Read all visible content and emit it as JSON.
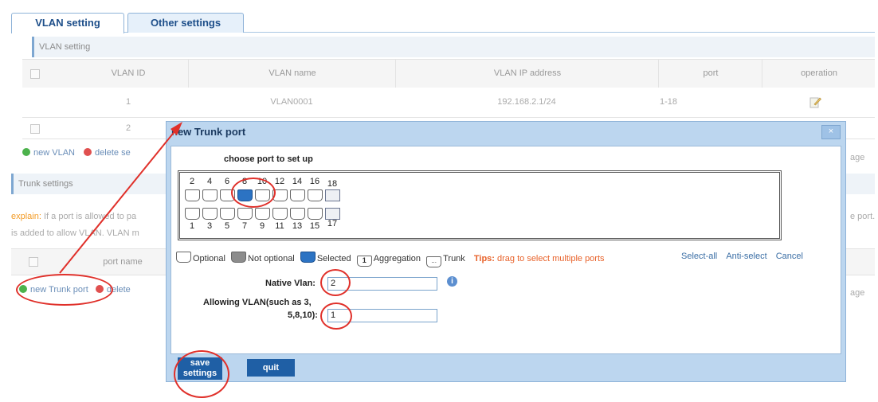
{
  "tabs": [
    {
      "label": "VLAN setting",
      "active": true
    },
    {
      "label": "Other settings",
      "active": false
    }
  ],
  "vlan_section": {
    "title": "VLAN setting",
    "columns": [
      "VLAN ID",
      "VLAN name",
      "VLAN IP address",
      "port",
      "operation"
    ],
    "rows": [
      {
        "id": "1",
        "name": "VLAN0001",
        "ip": "192.168.2.1/24",
        "port": "1-18"
      },
      {
        "id": "2",
        "name": "",
        "ip": "",
        "port": ""
      }
    ],
    "actions": {
      "new": "new VLAN",
      "delete": "delete se"
    },
    "page_hint": "age"
  },
  "trunk_section": {
    "title": "Trunk settings",
    "explain_label": "explain:",
    "explain_text_1": "If a port is allowed to pa",
    "explain_text_2": "is added to allow VLAN. VLAN m",
    "explain_right": "e port.",
    "columns": [
      "port name"
    ],
    "actions": {
      "new": "new Trunk port",
      "delete": "delete"
    },
    "page_hint": "age"
  },
  "modal": {
    "title": "new Trunk port",
    "close": "×",
    "subtitle": "choose port to set up",
    "top_port_numbers": [
      "2",
      "4",
      "6",
      "8",
      "10",
      "12",
      "14",
      "16",
      "18"
    ],
    "bottom_port_numbers": [
      "1",
      "3",
      "5",
      "7",
      "9",
      "11",
      "13",
      "15",
      "17"
    ],
    "selected_port": "8",
    "legend": {
      "optional": "Optional",
      "not_optional": "Not optional",
      "selected": "Selected",
      "aggregation": "Aggregation",
      "aggregation_badge": "1",
      "trunk": "Trunk",
      "trunk_badge": "...",
      "tips_label": "Tips:",
      "tips_text": "drag to select multiple ports",
      "select_all": "Select-all",
      "anti_select": "Anti-select",
      "cancel": "Cancel"
    },
    "native_vlan_label": "Native Vlan:",
    "native_vlan_value": "2",
    "allowing_vlan_label_1": "Allowing VLAN(such as 3,",
    "allowing_vlan_label_2": "5,8,10):",
    "allowing_vlan_value": "1",
    "save_button_line1": "save",
    "save_button_line2": "settings",
    "quit_button": "quit"
  },
  "colors": {
    "accent": "#1f5fa5",
    "annotation": "#e0302a",
    "explain": "#f39b25"
  }
}
